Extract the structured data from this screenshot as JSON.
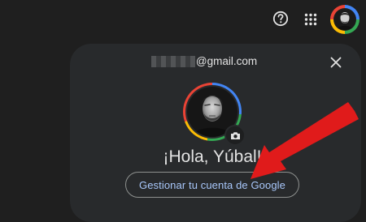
{
  "topbar": {
    "help_icon": "help-circle-icon",
    "apps_icon": "apps-grid-icon",
    "avatar_icon": "account-avatar"
  },
  "account_panel": {
    "email_suffix": "@gmail.com",
    "close_icon": "close-icon",
    "camera_icon": "camera-icon",
    "greeting": "¡Hola, Yúbal!",
    "manage_button_label": "Gestionar tu cuenta de Google"
  },
  "annotation": {
    "arrow_color": "#e01b1b"
  },
  "colors": {
    "background": "#1f1f1f",
    "panel": "#282a2c",
    "link_blue": "#a8c7fa",
    "google_blue": "#4285f4",
    "google_green": "#34a853",
    "google_yellow": "#fbbc04",
    "google_red": "#ea4335"
  }
}
